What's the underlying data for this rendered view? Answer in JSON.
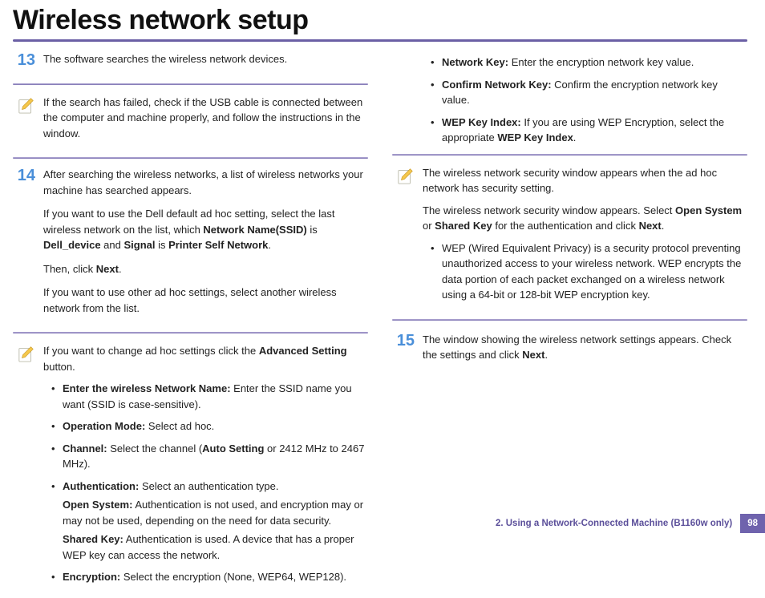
{
  "title": "Wireless network setup",
  "left": {
    "step13": {
      "num": "13",
      "text": "The software searches the wireless network devices."
    },
    "note1": {
      "text": "If the search has failed, check if the USB cable is connected between the computer and machine properly, and follow the instructions in the window."
    },
    "step14": {
      "num": "14",
      "p1": "After searching the wireless networks, a list of wireless networks your machine has searched appears.",
      "p2a": "If you want to use the Dell default ad hoc setting, select the last wireless network on the list, which ",
      "p2b_bold": "Network Name(SSID)",
      "p2c": " is ",
      "p2d_bold": "Dell_device",
      "p2e": " and ",
      "p2f_bold": "Signal",
      "p2g": " is ",
      "p2h_bold": "Printer Self Network",
      "p2i": ".",
      "p3a": "Then, click ",
      "p3b_bold": "Next",
      "p3c": ".",
      "p4": "If you want to use other ad hoc settings, select another wireless network from the list."
    },
    "note2": {
      "lead_a": "If you want to change ad hoc settings click the ",
      "lead_b_bold": "Advanced Setting",
      "lead_c": " button.",
      "items": [
        {
          "label": "Enter the wireless Network Name:",
          "text": " Enter the SSID name you want (SSID is case-sensitive)."
        },
        {
          "label": "Operation Mode:",
          "text": " Select ad hoc."
        },
        {
          "label": "Channel:",
          "text_a": " Select the channel (",
          "text_b_bold": "Auto Setting",
          "text_c": " or 2412 MHz to 2467 MHz)."
        },
        {
          "label": "Authentication:",
          "text": " Select an authentication type.",
          "sub1_label": "Open System:",
          "sub1_text": " Authentication is not used, and encryption may or may not be used, depending on the need for data security.",
          "sub2_label": "Shared Key:",
          "sub2_text": " Authentication is used. A device that has a proper WEP key can access the network."
        },
        {
          "label": "Encryption:",
          "text": " Select the encryption (None, WEP64, WEP128)."
        }
      ]
    }
  },
  "right": {
    "cont_items": [
      {
        "label": "Network Key:",
        "text": " Enter the encryption network key value."
      },
      {
        "label": "Confirm Network Key:",
        "text": " Confirm the encryption network key value."
      },
      {
        "label": "WEP Key Index:",
        "text_a": " If you are using WEP Encryption, select the appropriate ",
        "text_b_bold": "WEP Key Index",
        "text_c": "."
      }
    ],
    "note3": {
      "p1": "The wireless network security window appears when the ad hoc network has security setting.",
      "p2a": "The wireless network security window appears. Select ",
      "p2b_bold": "Open System",
      "p2c": " or ",
      "p2d_bold": "Shared Key",
      "p2e": " for the authentication and click ",
      "p2f_bold": "Next",
      "p2g": ".",
      "bullet": "WEP (Wired Equivalent Privacy) is a security protocol preventing unauthorized access to your wireless network. WEP encrypts the data portion of each packet exchanged on a wireless network using a 64-bit or 128-bit WEP encryption key."
    },
    "step15": {
      "num": "15",
      "a": "The window showing the wireless network settings appears. Check the settings and click ",
      "b_bold": "Next",
      "c": "."
    }
  },
  "footer": {
    "text": "2.  Using a Network-Connected Machine (B1160w only)",
    "page": "98"
  }
}
